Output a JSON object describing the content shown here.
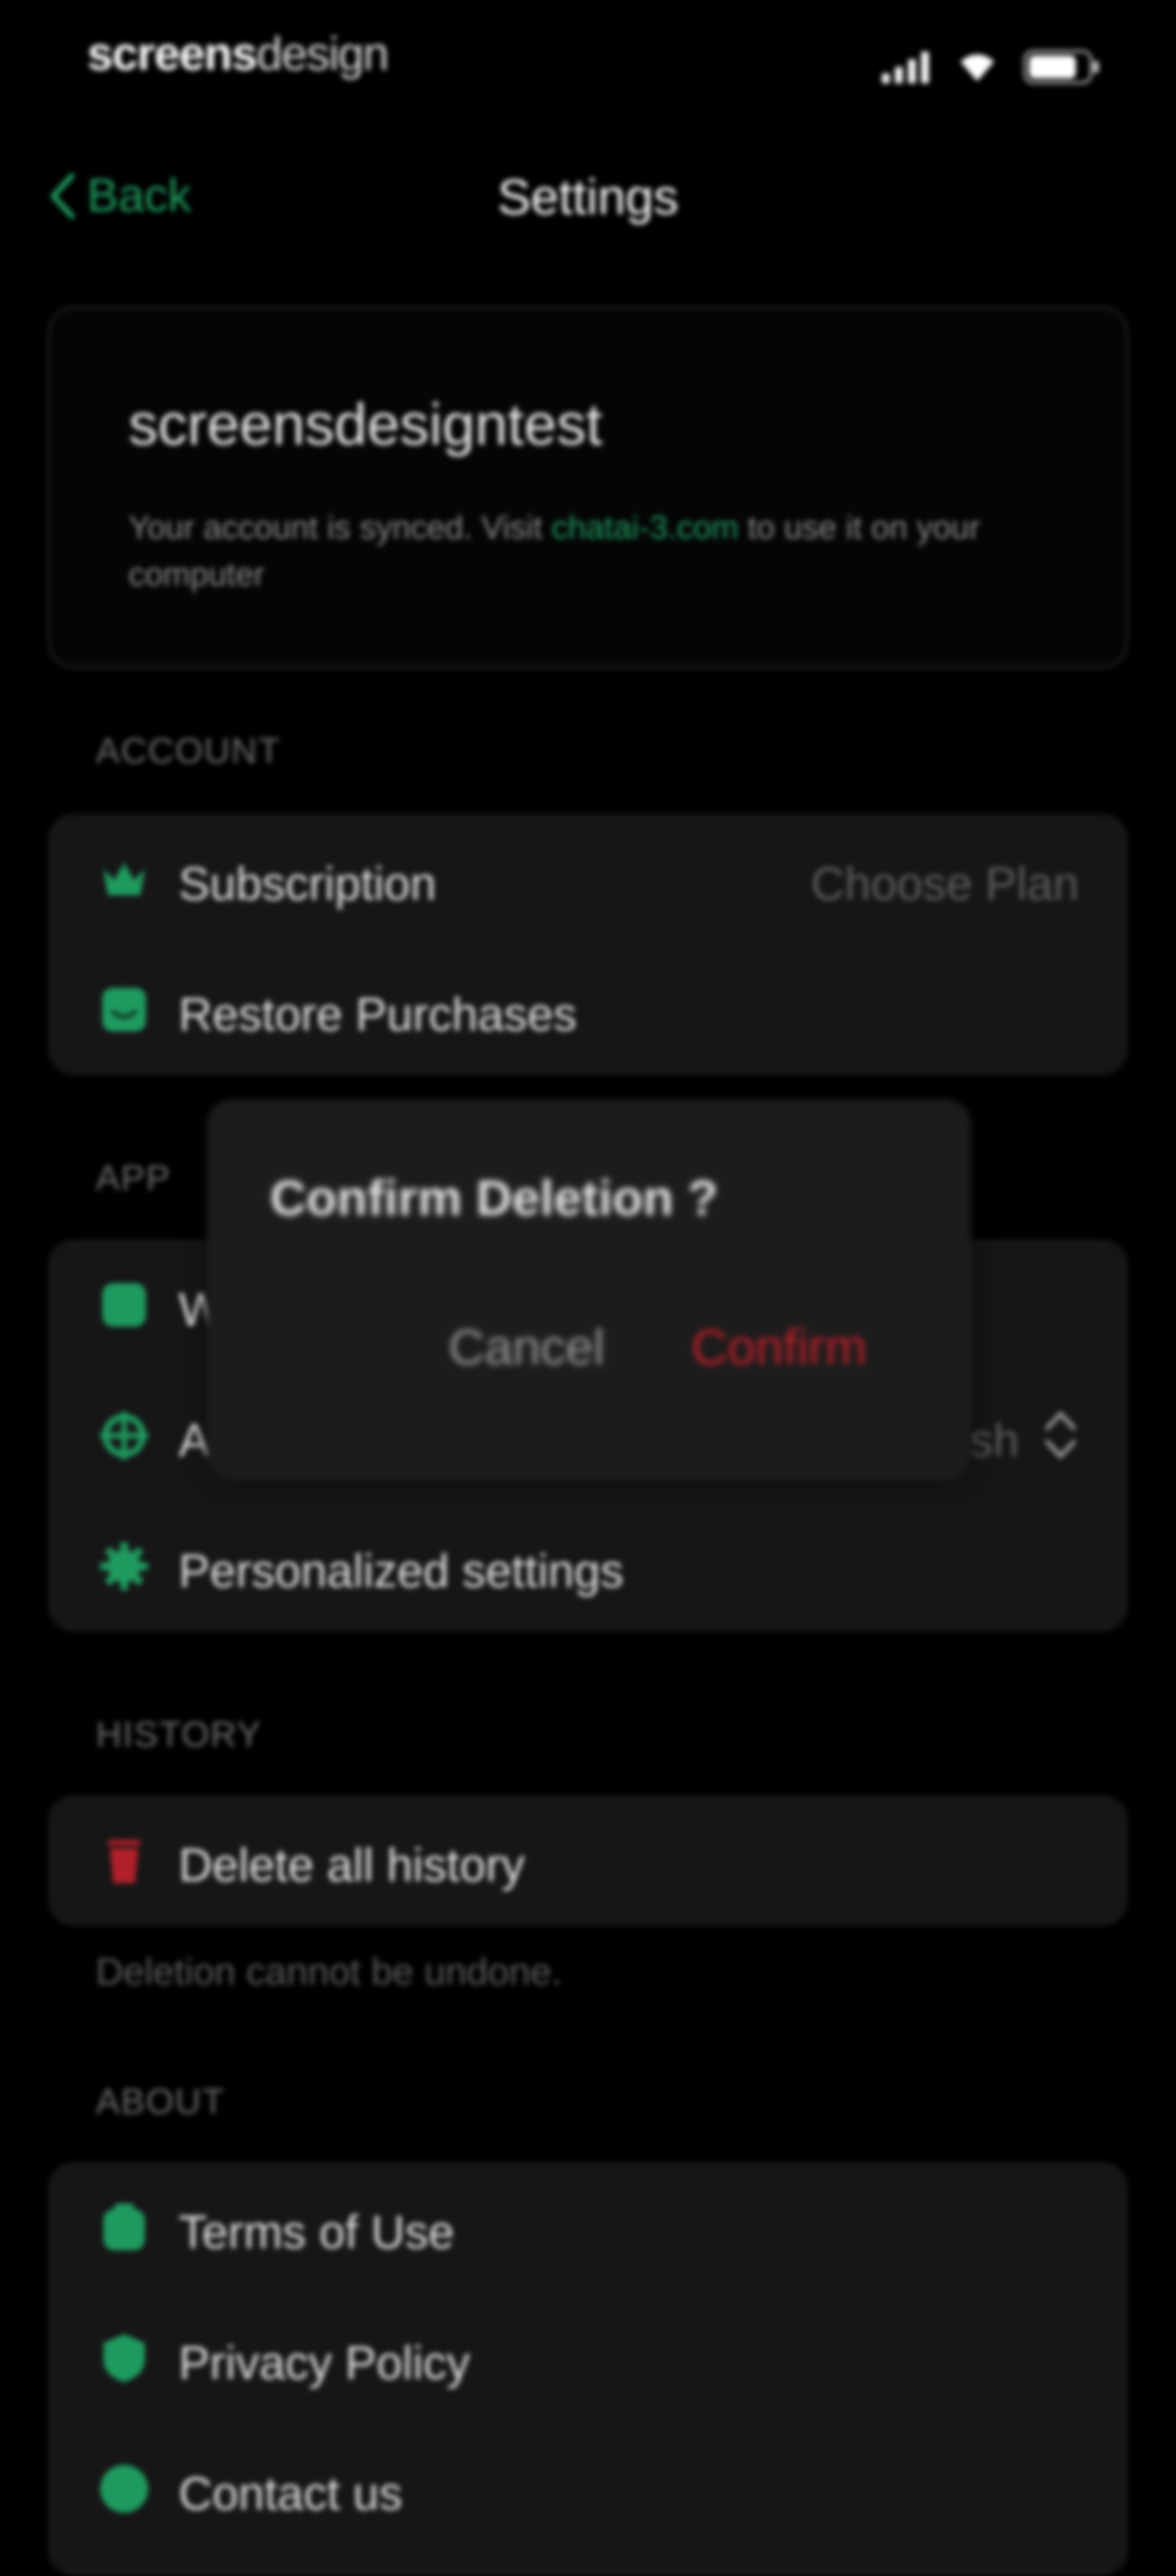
{
  "status_bar": {
    "brand_bold": "screens",
    "brand_light": "design"
  },
  "nav": {
    "back_label": "Back",
    "title": "Settings"
  },
  "account_card": {
    "username": "screensdesigntest",
    "note_prefix": "Your account is synced. Visit ",
    "note_link": "chatai-3.com",
    "note_suffix": " to use it on your computer"
  },
  "sections": {
    "account": {
      "header": "ACCOUNT",
      "items": [
        {
          "label": "Subscription",
          "value": "Choose Plan",
          "icon": "crown-icon"
        },
        {
          "label": "Restore Purchases",
          "icon": "restore-icon"
        }
      ]
    },
    "app": {
      "header": "APP",
      "items": [
        {
          "label": "W",
          "icon": "widget-icon"
        },
        {
          "label": "A",
          "value": "sh",
          "icon": "crosshair-icon"
        },
        {
          "label": "Personalized settings",
          "icon": "gear-icon"
        }
      ]
    },
    "history": {
      "header": "HISTORY",
      "items": [
        {
          "label": "Delete all history",
          "icon": "trash-icon"
        }
      ],
      "footnote": "Deletion cannot be undone."
    },
    "about": {
      "header": "ABOUT",
      "items": [
        {
          "label": "Terms of Use",
          "icon": "document-icon"
        },
        {
          "label": "Privacy Policy",
          "icon": "shield-icon"
        },
        {
          "label": "Contact us",
          "icon": "mail-icon"
        }
      ]
    }
  },
  "dialog": {
    "title": "Confirm Deletion ?",
    "cancel_label": "Cancel",
    "confirm_label": "Confirm"
  },
  "colors": {
    "accent": "#1f9a5f",
    "danger": "#c0202a",
    "background": "#000000",
    "card": "#161616"
  }
}
